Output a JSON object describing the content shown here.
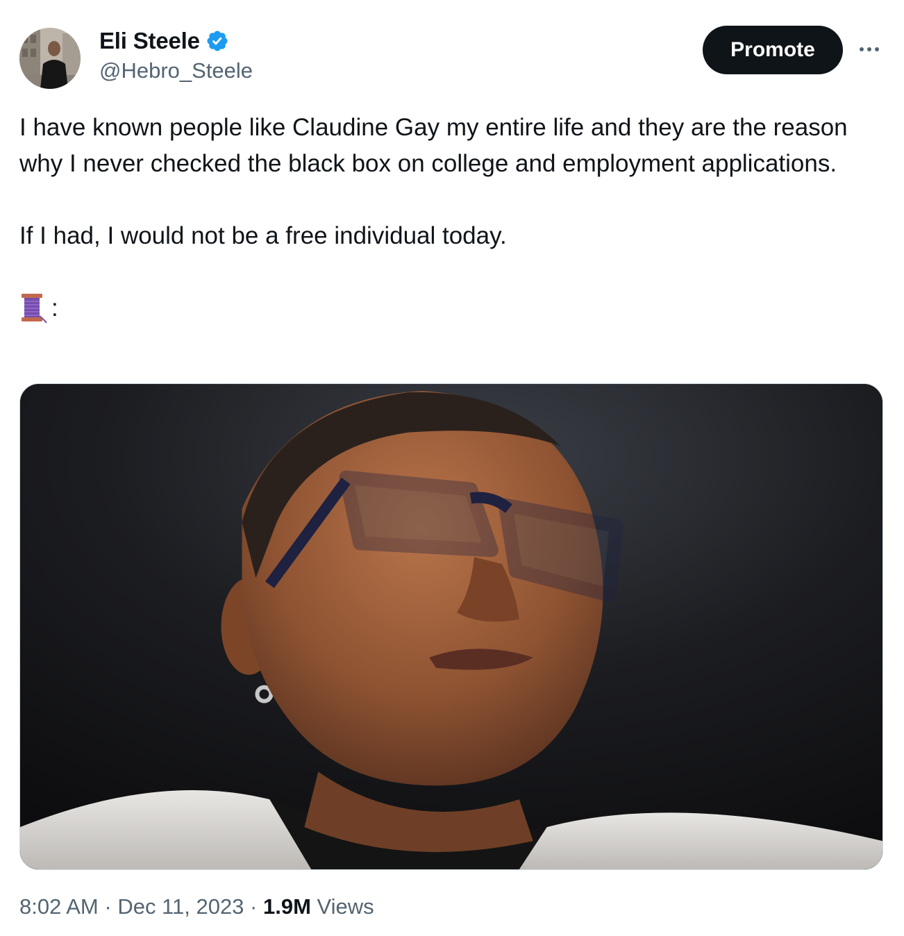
{
  "author": {
    "display_name": "Eli Steele",
    "handle": "@Hebro_Steele",
    "verified": true,
    "avatar_icon": "profile-photo"
  },
  "actions": {
    "promote_label": "Promote",
    "more_icon": "ellipsis-icon"
  },
  "tweet": {
    "paragraph_1": "I have known people like Claudine Gay my entire life and they are the reason why I never checked the black box on college and employment applications.",
    "paragraph_2": "If I had, I would not be a free individual today.",
    "thread_emoji": "🧵",
    "thread_suffix": ":"
  },
  "media": {
    "type": "photo"
  },
  "meta": {
    "time": "8:02 AM",
    "separator": " · ",
    "date": "Dec 11, 2023",
    "views_count": "1.9M",
    "views_label": " Views"
  },
  "colors": {
    "text_primary": "#0f1419",
    "text_secondary": "#536471",
    "verified_blue": "#1d9bf0",
    "button_dark": "#0f1419"
  }
}
